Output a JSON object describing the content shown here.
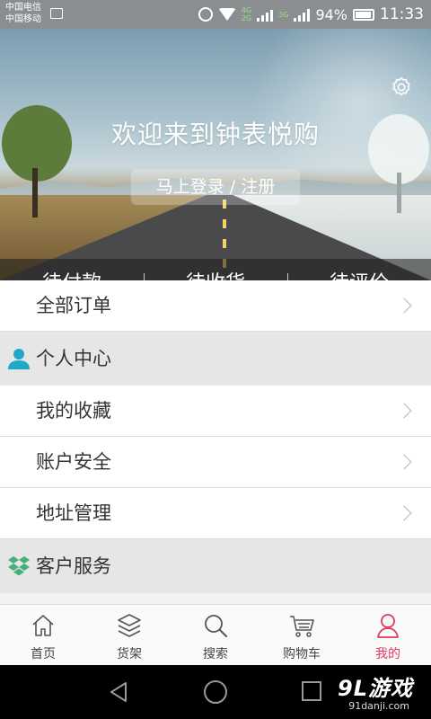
{
  "status_bar": {
    "carrier_1": "中国电信",
    "carrier_2": "中国移动",
    "net_4g": "4G",
    "net_2g": "2G",
    "net_3g": "3G",
    "battery": "94%",
    "time": "11:33"
  },
  "header": {
    "welcome": "欢迎来到钟表悦购",
    "login": "马上登录 / 注册",
    "settings_icon": "gear-icon"
  },
  "order_tabs": [
    {
      "label": "待付款"
    },
    {
      "label": "待收货"
    },
    {
      "label": "待评价"
    }
  ],
  "menu": {
    "all_orders": "全部订单",
    "personal_center": "个人中心",
    "favorites": "我的收藏",
    "account_security": "账户安全",
    "address_mgmt": "地址管理",
    "customer_service": "客户服务"
  },
  "bottom_nav": [
    {
      "label": "首页",
      "icon": "home-icon"
    },
    {
      "label": "货架",
      "icon": "layers-icon"
    },
    {
      "label": "搜索",
      "icon": "search-icon"
    },
    {
      "label": "购物车",
      "icon": "cart-icon"
    },
    {
      "label": "我的",
      "icon": "user-icon",
      "active": true
    }
  ],
  "watermark": {
    "brand": "9L游戏",
    "site": "91danji.com"
  },
  "colors": {
    "accent": "#e2395d",
    "person_icon": "#1fa9c9",
    "service_icon": "#46b07a"
  }
}
